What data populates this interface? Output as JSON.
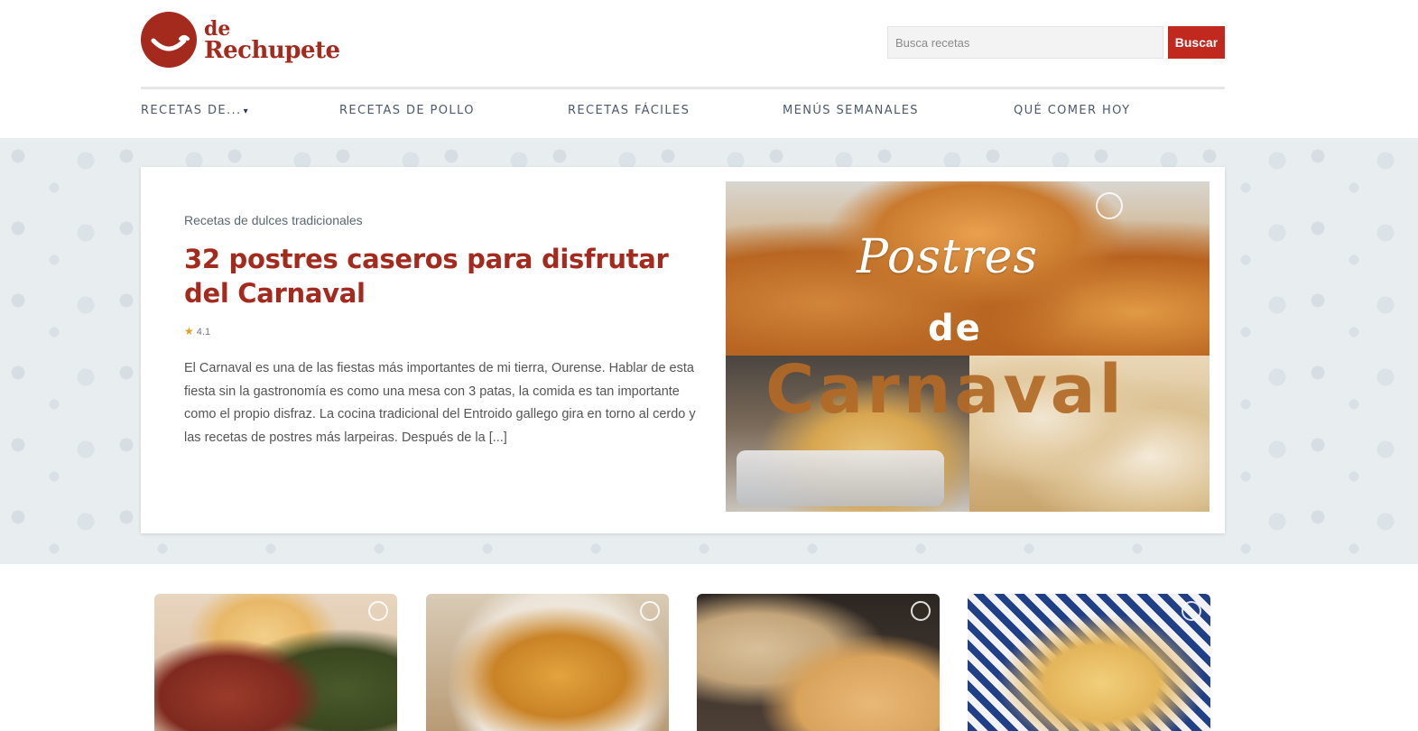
{
  "brand": {
    "logo_small": "de",
    "logo_name": "Rechupete",
    "color": "#a42a1e"
  },
  "search": {
    "placeholder": "Busca recetas",
    "button_label": "Buscar",
    "button_color": "#c1281e"
  },
  "nav": {
    "items": [
      {
        "label": "RECETAS DE...",
        "has_dropdown": true,
        "caret": "▾"
      },
      {
        "label": "RECETAS DE POLLO"
      },
      {
        "label": "RECETAS FÁCILES"
      },
      {
        "label": "MENÚS SEMANALES"
      },
      {
        "label": "QUÉ COMER HOY"
      }
    ]
  },
  "hero": {
    "category": "Recetas de dulces tradicionales",
    "title": "32 postres caseros para disfrutar del Carnaval",
    "rating": "4.1",
    "rating_icon": "star-icon",
    "excerpt": "El Carnaval es una de las fiestas más importantes de mi tierra, Ourense. Hablar de esta fiesta sin la gastronomía es como una mesa con 3 patas, la comida es tan importante como el propio disfraz. La cocina tradicional del Entroido gallego gira en torno al cerdo y las recetas de postres más larpeiras. Después de la [...]",
    "image_text": {
      "line1": "Postres",
      "line2": "de",
      "line3": "Carnaval"
    }
  },
  "cards": [
    {
      "image": "card-image-1"
    },
    {
      "image": "card-image-2"
    },
    {
      "image": "card-image-3"
    },
    {
      "image": "card-image-4"
    }
  ]
}
